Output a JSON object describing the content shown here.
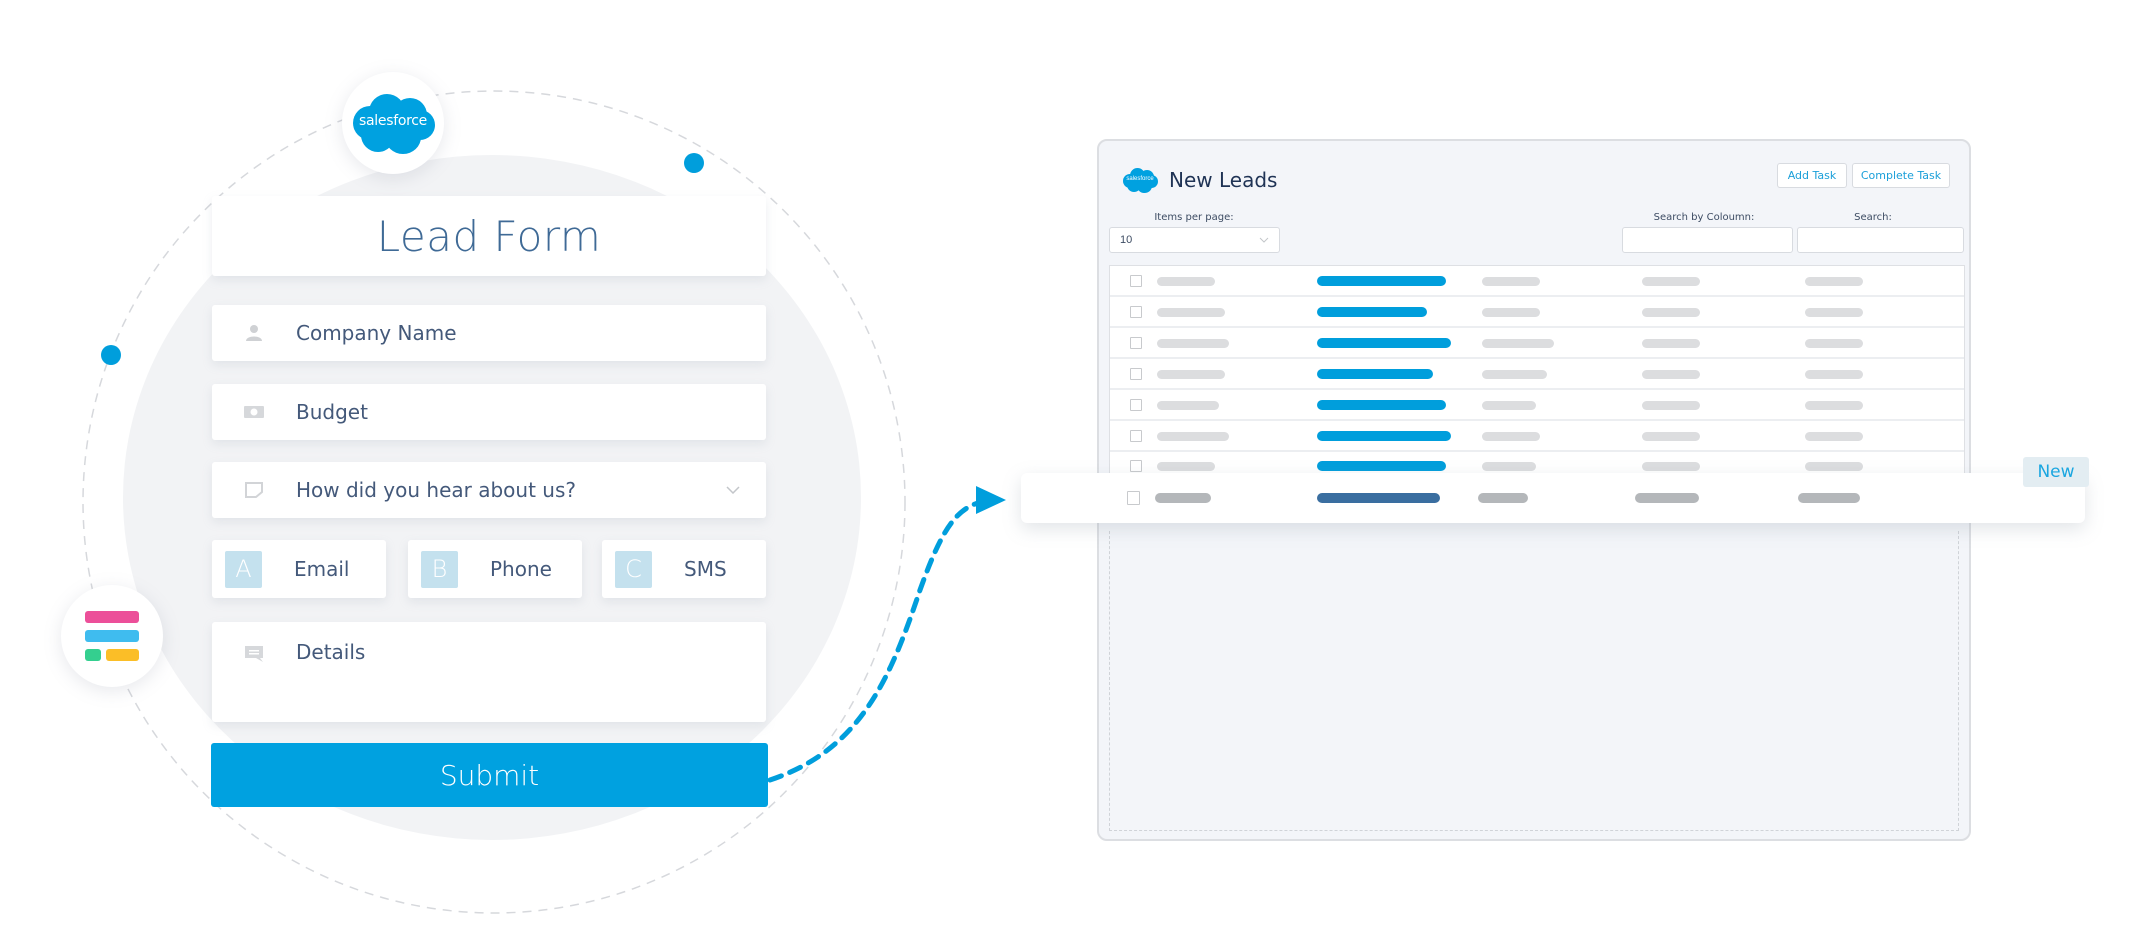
{
  "colors": {
    "brand_blue": "#00a1e0",
    "accent_dot": "#009edc",
    "title_text": "#3f6a96",
    "field_text": "#44597a",
    "option_letter_bg": "#c4e1ee",
    "highlight_bar": "#3a6ea0",
    "app_icon": [
      "#ec4f99",
      "#3fbcef",
      "#34cf8f",
      "#fbbe27"
    ]
  },
  "logos": {
    "salesforce_label": "salesforce",
    "salesforce_icon": "salesforce-cloud-logo",
    "app_icon": "form-builder-app-logo"
  },
  "lead_form": {
    "title": "Lead Form",
    "fields": [
      {
        "icon": "person-icon",
        "label": "Company Name"
      },
      {
        "icon": "money-icon",
        "label": "Budget"
      },
      {
        "icon": "note-icon",
        "label": "How did you hear about us?",
        "type": "dropdown"
      }
    ],
    "options": [
      {
        "letter": "A",
        "label": "Email"
      },
      {
        "letter": "B",
        "label": "Phone"
      },
      {
        "letter": "C",
        "label": "SMS"
      }
    ],
    "details": {
      "icon": "comment-icon",
      "label": "Details"
    },
    "submit_label": "Submit"
  },
  "leads_window": {
    "title": "New Leads",
    "buttons": {
      "add_task": "Add Task",
      "complete_task": "Complete Task"
    },
    "items_per_page_label": "Items per page:",
    "items_per_page_value": "10",
    "search_by_column_label": "Search by Coloumn:",
    "search_label": "Search:",
    "search_by_column_value": "",
    "search_value": "",
    "row_count": 7,
    "new_row_badge": "New"
  }
}
